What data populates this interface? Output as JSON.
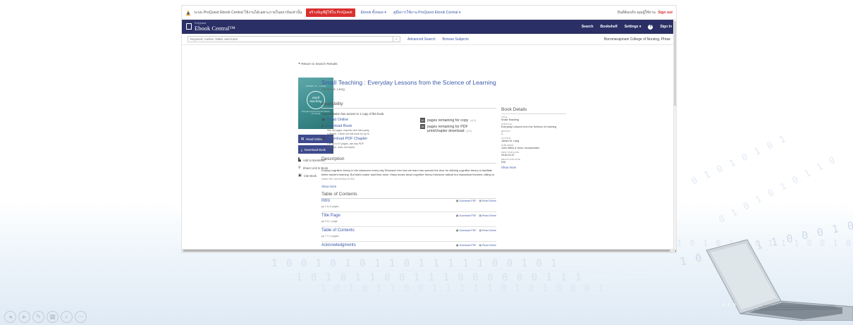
{
  "topbar": {
    "notice": "ระบบ ProQuest Ebook Central ใช้งานได้เฉพาะภายในสถาบันเท่านั้น",
    "button": "สร้างบัญชีผู้ใช้ใน ProQuest",
    "link1": "Ebook ทั้งหมด ▾",
    "link2": "คู่มือการใช้งาน ProQuest Ebook Central ▾",
    "welcome": "ยินดีต้อนรับ คุณผู้ใช้งาน",
    "signout": "Sign out"
  },
  "nav": {
    "logo_small": "ProQuest",
    "logo_big": "Ebook Central™",
    "search": "Search",
    "bookshelf": "Bookshelf",
    "settings": "Settings ▾",
    "help": "?",
    "signin": "Sign In"
  },
  "search": {
    "placeholder": "Keyword, Author, ISBN, and more",
    "go": "✓",
    "advanced": "Advanced Search",
    "browse": "Browse Subjects",
    "institution": "Boromarajonani College of Nursing, Phrae"
  },
  "return_link": "Return to Search Results",
  "cover": {
    "author": "JAMES M. LANG",
    "title": "small teaching",
    "subtitle": "Everyday Lessons from the Science of Learning"
  },
  "side_actions": {
    "read_online": "Read Online",
    "download_book": "Download Book",
    "bookmark": "Add to Bookshelf",
    "share": "Share Link to Book",
    "cite": "Cite Book"
  },
  "book": {
    "title": "Small Teaching : Everyday Lessons from the Science of Learning",
    "author": "James M. Lang"
  },
  "availability": {
    "heading": "Availability",
    "text": "Your institution has access to 1 copy of this book.",
    "read_online": "Read Online",
    "download_book": "Download Book",
    "download_book_sub": "See all pages, requires free third-party software. Check out this book for up to 7 day.",
    "download_chapter": "Download PDF Chapter",
    "download_chapter_sub": "Get up to 37 pages, use any PDF software, does not expire.",
    "copy_num": "40",
    "copy_text": "pages remaining for copy",
    "copy_unit": "(of 0)",
    "pdf_num": "35",
    "pdf_text": "pages remaining for PDF",
    "pdf_text2": "print/chapter download",
    "pdf_unit": "(of 0)"
  },
  "description": {
    "heading": "Description",
    "text": "Employ cognitive theory in the classroom every day Research into how we learn has opened the door for utilizing cognitive theory to facilitate better student learning. But that's easier said than done. Many books about cognitive theory introduce radical but impractical theories, failing to make the connection to the",
    "show_more": "Show more"
  },
  "toc": {
    "heading": "Table of Contents",
    "items": [
      {
        "title": "Intro",
        "pages": "pp 1-6 | 6 pages"
      },
      {
        "title": "Title Page",
        "pages": "pp 3-3 | 1 page"
      },
      {
        "title": "Table of Contents",
        "pages": "pp 7-7 | 4 pages"
      },
      {
        "title": "Acknowledgments",
        "pages": ""
      }
    ],
    "download_pdf": "Download PDF",
    "read_online": "Read Online"
  },
  "details": {
    "heading": "Book Details",
    "rows": [
      {
        "label": "TITLE",
        "value": "Small Teaching"
      },
      {
        "label": "SUBTITLE",
        "value": "Everyday Lessons from the Science of Learning"
      },
      {
        "label": "EDITION",
        "value": "1"
      },
      {
        "label": "AUTHOR",
        "value": "James M. Lang"
      },
      {
        "label": "PUBLISHER",
        "value": "John Wiley & Sons, Incorporated"
      },
      {
        "label": "PRINT PUB DATE",
        "value": "2016-03-07"
      },
      {
        "label": "EBOOK PUB DATE",
        "value": "N/A"
      }
    ],
    "show_more": "Show more"
  },
  "binary": {
    "line1": "1 0 0 1 0 1 0 1 1 0 1 1 1 1 1 0 0 1 0 1",
    "line2": "1 0 1 0 1 1 0 0 1 1 1 0 0 0 0 0 0 1 1 1",
    "line3": "1 0 1 0 1 1 0 0 1 1 1 1 1 0 1 0 1 0 0 0 1",
    "line4": "1 0 1 0 1 1 1 0 0 0 1 0 1 0 0 1 1 1 1 1",
    "line5": "1 0 1 0 1 1 0 1 1 1 0 0 1 0",
    "line6": "0 1 0 1 0 1 0 1",
    "line7": "0 1 0 1 0 1 0 1 1 0"
  },
  "controls": [
    "◂",
    "▸",
    "✎",
    "▦",
    "⌕",
    "⋯"
  ]
}
